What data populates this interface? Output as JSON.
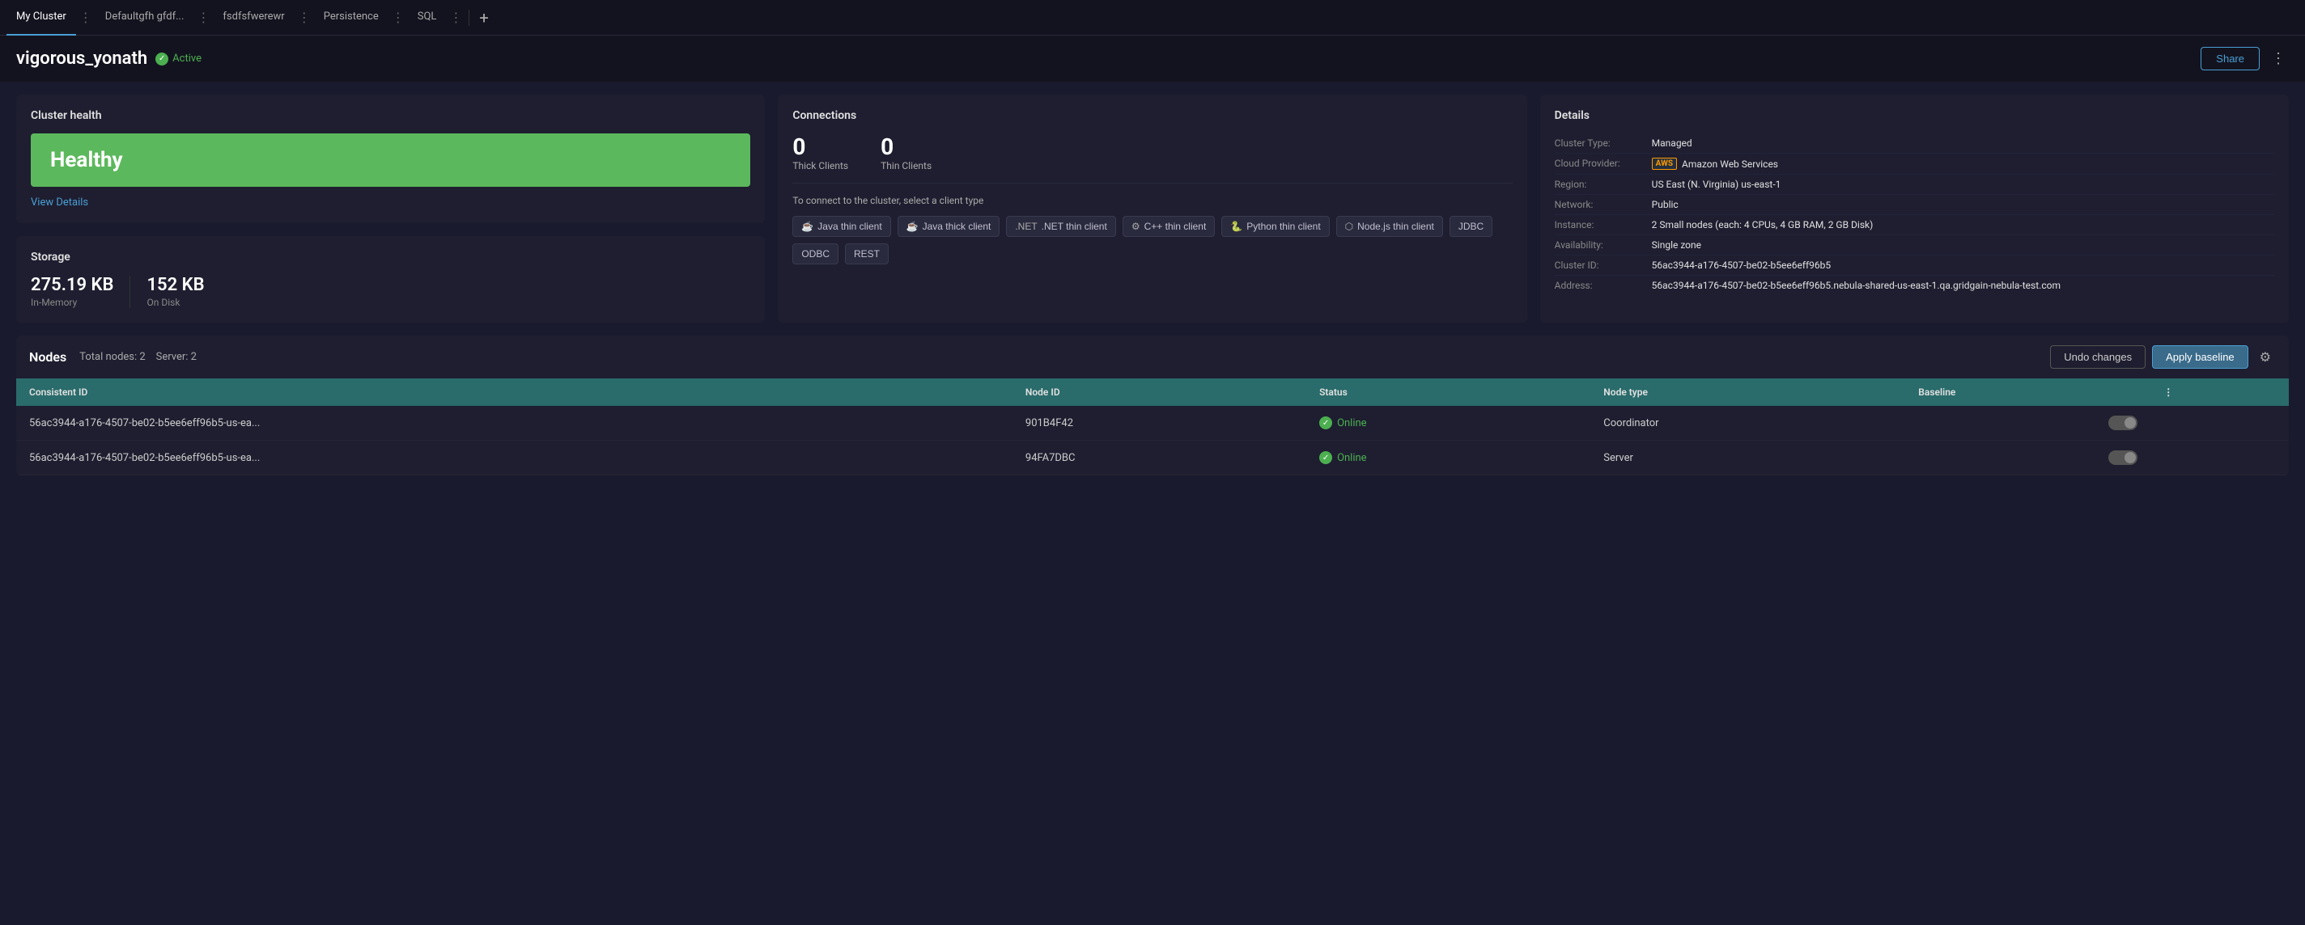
{
  "tabs": [
    {
      "id": "my-cluster",
      "label": "My Cluster",
      "active": true
    },
    {
      "id": "defaultgfh",
      "label": "Defaultgfh gfdf...",
      "active": false
    },
    {
      "id": "fsdfsfwerewr",
      "label": "fsdfsfwerewr",
      "active": false
    },
    {
      "id": "persistence",
      "label": "Persistence",
      "active": false
    },
    {
      "id": "sql",
      "label": "SQL",
      "active": false
    }
  ],
  "header": {
    "cluster_name": "vigorous_yonath",
    "status_label": "Active",
    "share_button": "Share"
  },
  "cluster_health": {
    "card_title": "Cluster health",
    "health_status": "Healthy",
    "view_details_link": "View Details"
  },
  "storage": {
    "card_title": "Storage",
    "in_memory_value": "275.19 KB",
    "in_memory_label": "In-Memory",
    "on_disk_value": "152 KB",
    "on_disk_label": "On Disk"
  },
  "connections": {
    "card_title": "Connections",
    "thick_count": "0",
    "thick_label": "Thick Clients",
    "thin_count": "0",
    "thin_label": "Thin Clients",
    "connect_desc": "To connect to the cluster, select a client type",
    "clients": [
      {
        "id": "java-thin",
        "icon": "☕",
        "label": "Java thin client"
      },
      {
        "id": "java-thick",
        "icon": "☕",
        "label": "Java thick client"
      },
      {
        "id": "net-thin",
        "icon": ".NET",
        "label": ".NET thin client"
      },
      {
        "id": "cpp-thin",
        "icon": "⚙",
        "label": "C++ thin client"
      },
      {
        "id": "python-thin",
        "icon": "🐍",
        "label": "Python thin client"
      },
      {
        "id": "nodejs-thin",
        "icon": "⬡",
        "label": "Node.js thin client"
      },
      {
        "id": "jdbc",
        "icon": "",
        "label": "JDBC"
      },
      {
        "id": "odbc",
        "icon": "",
        "label": "ODBC"
      },
      {
        "id": "rest",
        "icon": "",
        "label": "REST"
      }
    ]
  },
  "details": {
    "card_title": "Details",
    "rows": [
      {
        "key": "Cluster Type:",
        "value": "Managed",
        "aws": false
      },
      {
        "key": "Cloud Provider:",
        "value": "Amazon Web Services",
        "aws": true
      },
      {
        "key": "Region:",
        "value": "US East (N. Virginia) us-east-1",
        "aws": false
      },
      {
        "key": "Network:",
        "value": "Public",
        "aws": false
      },
      {
        "key": "Instance:",
        "value": "2 Small nodes (each: 4 CPUs, 4 GB RAM, 2 GB Disk)",
        "aws": false
      },
      {
        "key": "Availability:",
        "value": "Single zone",
        "aws": false
      },
      {
        "key": "Cluster ID:",
        "value": "56ac3944-a176-4507-be02-b5ee6eff96b5",
        "aws": false
      },
      {
        "key": "Address:",
        "value": "56ac3944-a176-4507-be02-b5ee6eff96b5.nebula-shared-us-east-1.qa.gridgain-nebula-test.com",
        "aws": false
      }
    ]
  },
  "nodes": {
    "section_title": "Nodes",
    "total_nodes_label": "Total nodes:",
    "total_nodes_value": "2",
    "server_label": "Server:",
    "server_value": "2",
    "undo_button": "Undo changes",
    "apply_button": "Apply baseline",
    "columns": [
      "Consistent ID",
      "Node ID",
      "Status",
      "Node type",
      "Baseline"
    ],
    "rows": [
      {
        "consistent_id": "56ac3944-a176-4507-be02-b5ee6eff96b5-us-ea...",
        "node_id": "901B4F42",
        "status": "Online",
        "node_type": "Coordinator",
        "baseline": true
      },
      {
        "consistent_id": "56ac3944-a176-4507-be02-b5ee6eff96b5-us-ea...",
        "node_id": "94FA7DBC",
        "status": "Online",
        "node_type": "Server",
        "baseline": true
      }
    ]
  }
}
